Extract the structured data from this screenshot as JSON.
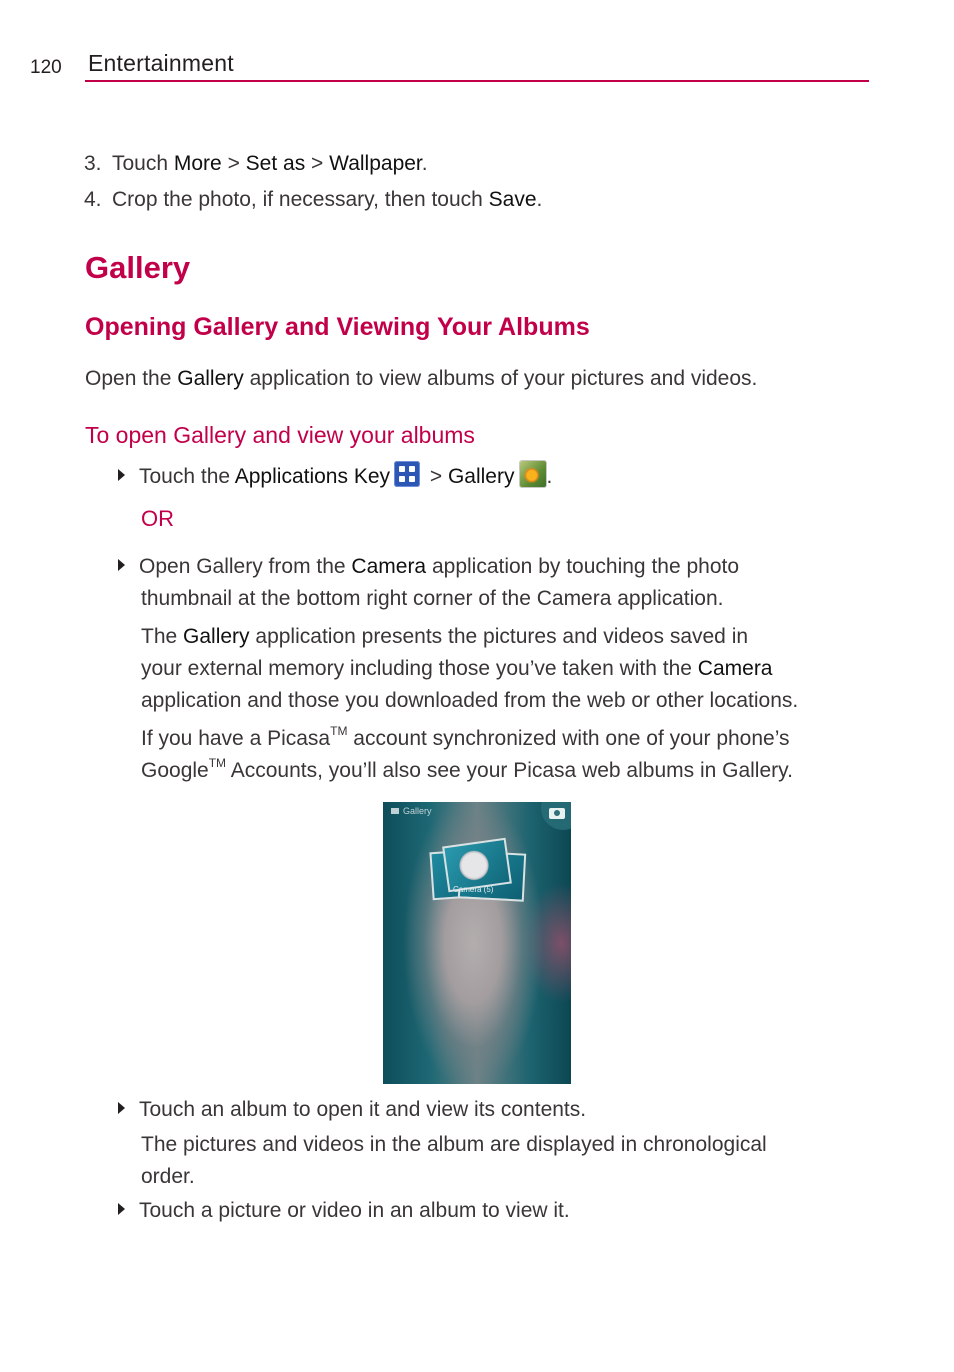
{
  "header": {
    "page_number": "120",
    "chapter": "Entertainment",
    "accent_color": "#c2004a"
  },
  "steps": [
    {
      "num": "3.",
      "parts": [
        {
          "t": "Touch "
        },
        {
          "t": "More",
          "b": true
        },
        {
          "t": " > "
        },
        {
          "t": "Set as",
          "b": true
        },
        {
          "t": " > "
        },
        {
          "t": "Wallpaper",
          "b": true
        },
        {
          "t": "."
        }
      ]
    },
    {
      "num": "4.",
      "parts": [
        {
          "t": "Crop the photo, if necessary, then touch "
        },
        {
          "t": "Save",
          "b": true
        },
        {
          "t": "."
        }
      ]
    }
  ],
  "section": {
    "title": "Gallery",
    "subtitle": "Opening Gallery and Viewing Your Albums",
    "intro": {
      "pre": "Open the ",
      "bold": "Gallery",
      "post": " application to view albums of your pictures and videos."
    },
    "procedure_title": "To open Gallery and view your albums",
    "bullet1": {
      "pre": "Touch the ",
      "key": "Applications Key",
      "sep": " > ",
      "app": "Gallery",
      "end": ".",
      "icons": [
        "applications-key-icon",
        "gallery-app-icon"
      ]
    },
    "or_label": "OR",
    "bullet2": {
      "line1": {
        "pre": "Open Gallery from the ",
        "bold": "Camera",
        "post": " application by touching the photo"
      },
      "line2": "thumbnail at the bottom right corner of the Camera application."
    },
    "para1": {
      "line1": {
        "pre": "The ",
        "bold": "Gallery",
        "post": " application presents the pictures and videos saved in"
      },
      "line2": {
        "pre": "your external memory including those you’ve taken with the ",
        "bold": "Camera"
      },
      "line3": "application and those you downloaded from the web or other locations."
    },
    "para2": {
      "line1": {
        "pre": "If you have a Picasa",
        "tm": "TM",
        "post": " account synchronized with one of your phone’s"
      },
      "line2": {
        "pre": "Google",
        "tm": "TM",
        "post": " Accounts, you’ll also see your Picasa web albums in Gallery."
      }
    },
    "screenshot": {
      "title_bar": "Gallery",
      "album_label": "Camera (5)",
      "icons": [
        "gallery-icon",
        "camera-icon"
      ]
    },
    "bullet3": "Touch an album to open it and view its contents.",
    "para3": {
      "line1": "The pictures and videos in the album are displayed in chronological",
      "line2": "order."
    },
    "bullet4": "Touch a picture or video in an album to view it."
  }
}
